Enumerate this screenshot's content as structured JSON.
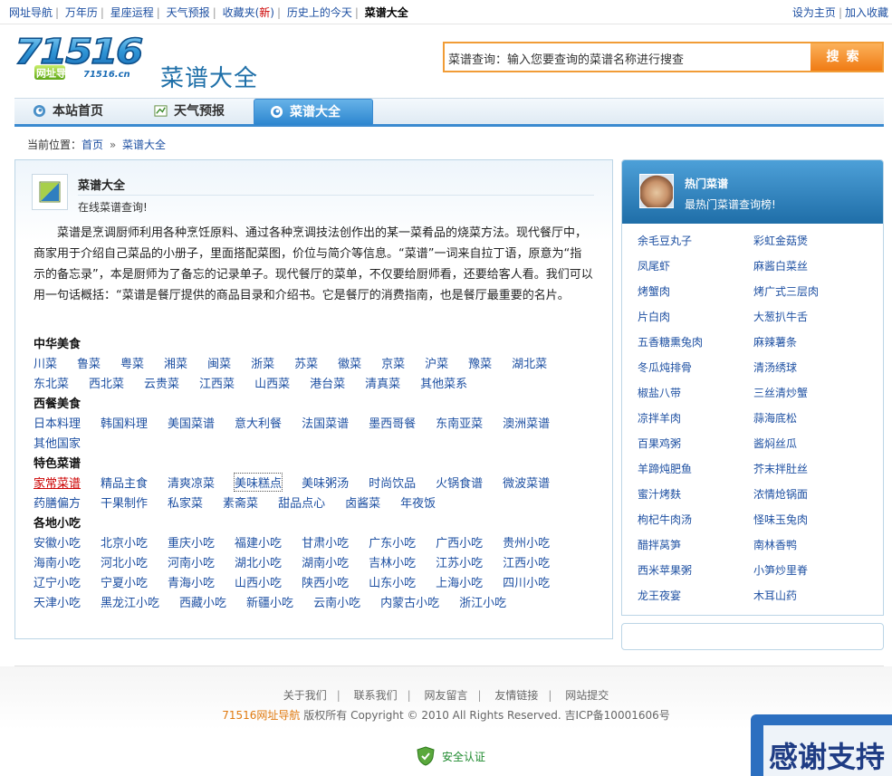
{
  "topnav": {
    "items": [
      "网址导航",
      "万年历",
      "星座运程",
      "天气预报"
    ],
    "favorites": "收藏夹(",
    "favorites_new": "新",
    "favorites_close": ")",
    "history": "历史上的今天",
    "current": "菜谱大全",
    "set_home": "设为主页",
    "add_fav": "加入收藏"
  },
  "header": {
    "logo_number": "71516",
    "logo_caption": "网址导航",
    "logo_domain": "71516.cn",
    "title": "菜谱大全",
    "search_placeholder": "菜谱查询：输入您要查询的菜谱名称进行搜查",
    "search_button": "搜索"
  },
  "tabs": [
    "本站首页",
    "天气预报",
    "菜谱大全"
  ],
  "breadcrumb": {
    "prefix": "当前位置：",
    "home": "首页",
    "sep": "»",
    "current": "菜谱大全"
  },
  "section": {
    "title": "菜谱大全",
    "subtitle": "在线菜谱查询!",
    "intro": "菜谱是烹调厨师利用各种烹饪原料、通过各种烹调技法创作出的某一菜肴品的烧菜方法。现代餐厅中，商家用于介绍自己菜品的小册子，里面搭配菜图，价位与简介等信息。“菜谱”一词来自拉丁语，原意为“指示的备忘录”，本是厨师为了备忘的记录单子。现代餐厅的菜单，不仅要给厨师看，还要给客人看。我们可以用一句话概括：“菜谱是餐厅提供的商品目录和介绍书。它是餐厅的消费指南，也是餐厅最重要的名片。"
  },
  "categories": [
    {
      "title": "中华美食",
      "rows": [
        [
          "川菜",
          "鲁菜",
          "粤菜",
          "湘菜",
          "闽菜",
          "浙菜",
          "苏菜",
          "徽菜",
          "京菜",
          "沪菜",
          "豫菜",
          "湖北菜"
        ],
        [
          "东北菜",
          "西北菜",
          "云贵菜",
          "江西菜",
          "山西菜",
          "港台菜",
          "清真菜",
          "其他菜系"
        ]
      ]
    },
    {
      "title": "西餐美食",
      "rows": [
        [
          "日本料理",
          "韩国料理",
          "美国菜谱",
          "意大利餐",
          "法国菜谱",
          "墨西哥餐",
          "东南亚菜",
          "澳洲菜谱"
        ],
        [
          "其他国家"
        ]
      ]
    },
    {
      "title": "特色菜谱",
      "rows": [
        [
          "家常菜谱",
          "精品主食",
          "清爽凉菜",
          "美味糕点",
          "美味粥汤",
          "时尚饮品",
          "火锅食谱",
          "微波菜谱"
        ],
        [
          "药膳偏方",
          "干果制作",
          "私家菜",
          "素斋菜",
          "甜品点心",
          "卤酱菜",
          "年夜饭"
        ]
      ]
    },
    {
      "title": "各地小吃",
      "rows": [
        [
          "安徽小吃",
          "北京小吃",
          "重庆小吃",
          "福建小吃",
          "甘肃小吃",
          "广东小吃",
          "广西小吃",
          "贵州小吃"
        ],
        [
          "海南小吃",
          "河北小吃",
          "河南小吃",
          "湖北小吃",
          "湖南小吃",
          "吉林小吃",
          "江苏小吃",
          "江西小吃"
        ],
        [
          "辽宁小吃",
          "宁夏小吃",
          "青海小吃",
          "山西小吃",
          "陕西小吃",
          "山东小吃",
          "上海小吃",
          "四川小吃"
        ],
        [
          "天津小吃",
          "黑龙江小吃",
          "西藏小吃",
          "新疆小吃",
          "云南小吃",
          "内蒙古小吃",
          "浙江小吃"
        ]
      ]
    }
  ],
  "sidebar": {
    "title": "热门菜谱",
    "subtitle": "最热门菜谱查询榜!",
    "left": [
      "余毛豆丸子",
      "凤尾虾",
      "烤蟹肉",
      "片白肉",
      "五香糖熏兔肉",
      "冬瓜炖排骨",
      "椒盐八带",
      "凉拌羊肉",
      "百果鸡粥",
      "羊蹄炖肥鱼",
      "蜜汁烤麸",
      "枸杞牛肉汤",
      "醋拌莴笋",
      "西米苹果粥",
      "龙王夜宴"
    ],
    "right": [
      "彩虹金菇煲",
      "麻酱白菜丝",
      "烤广式三层肉",
      "大葱扒牛舌",
      "麻辣薯条",
      "清汤绣球",
      "三丝清炒蟹",
      "蒜海底松",
      "酱焖丝瓜",
      "芥末拌肚丝",
      "浓情炝锅面",
      "怪味玉兔肉",
      "南林香鸭",
      "小笋炒里脊",
      "木耳山药"
    ]
  },
  "footer": {
    "links": [
      "关于我们",
      "联系我们",
      "网友留言",
      "友情链接",
      "网站提交"
    ],
    "brand": "71516网址导航",
    "copyright": "版权所有 Copyright © 2010 All Rights Reserved. 吉ICP备10001606号",
    "secure": "安全认证",
    "thanks": "感谢支持"
  },
  "colors": {
    "link": "#1e50a2",
    "accent_blue": "#3a8ad0",
    "search_orange": "#f07b14",
    "new_red": "#cc0000"
  }
}
